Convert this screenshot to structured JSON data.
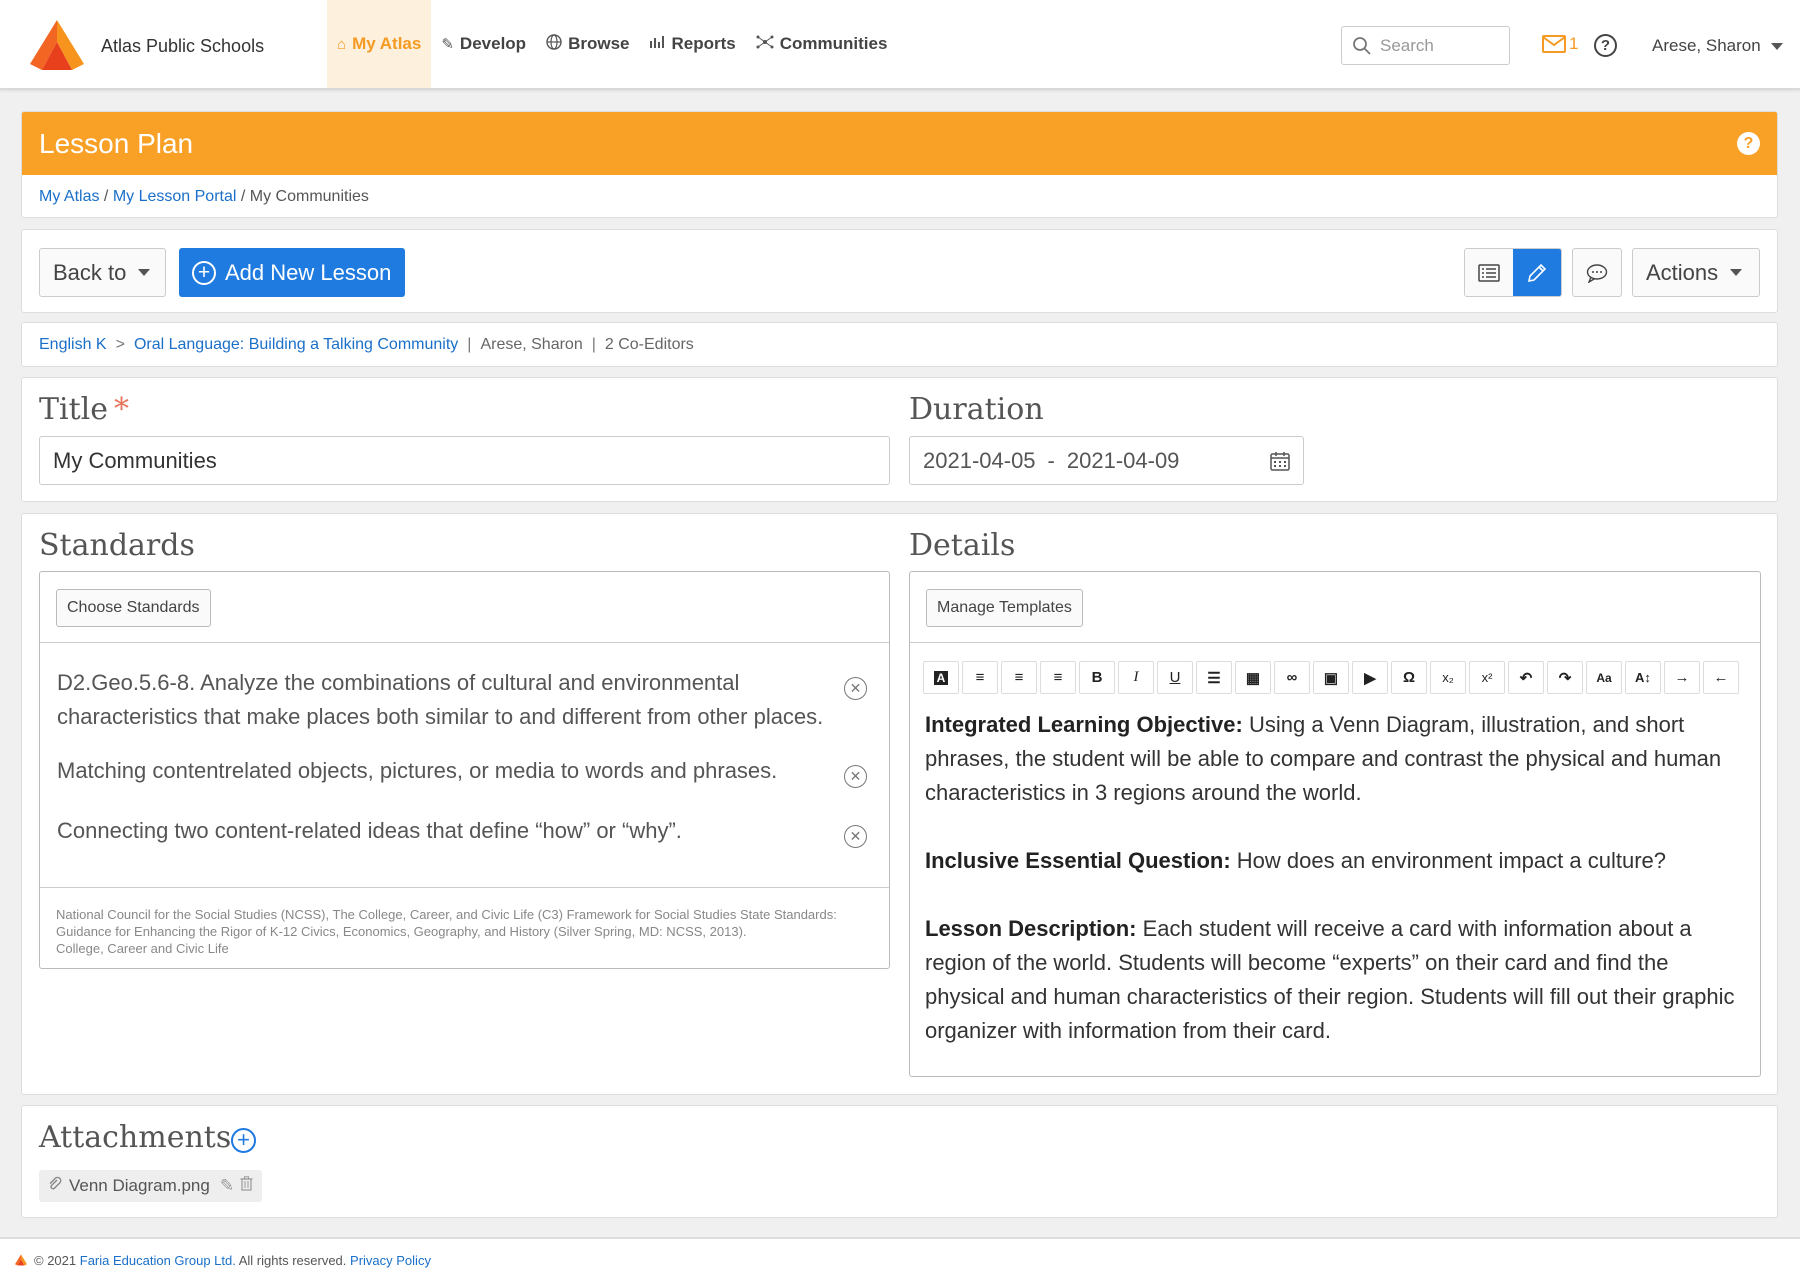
{
  "brand": {
    "name": "Atlas Public Schools",
    "accent": "#f59a23"
  },
  "nav": {
    "items": [
      {
        "label": "My Atlas",
        "icon": "home-icon",
        "active": true
      },
      {
        "label": "Develop",
        "icon": "edit-icon"
      },
      {
        "label": "Browse",
        "icon": "globe-icon"
      },
      {
        "label": "Reports",
        "icon": "bar-chart-icon"
      },
      {
        "label": "Communities",
        "icon": "network-icon"
      }
    ],
    "search_placeholder": "Search",
    "mail_count": "1",
    "help": "?",
    "user": "Arese, Sharon"
  },
  "page": {
    "title": "Lesson Plan",
    "help": "?",
    "breadcrumb": {
      "link1": "My Atlas",
      "link2": "My Lesson Portal",
      "current": "My Communities",
      "sep": " / "
    }
  },
  "toolbar": {
    "back_label": "Back to",
    "add_label": "Add New Lesson",
    "actions_label": "Actions"
  },
  "course": {
    "course": "English K",
    "arrow": ">",
    "unit": "Oral Language: Building a Talking Community",
    "author": "Arese, Sharon",
    "coeditors": "2 Co-Editors",
    "sep": "|"
  },
  "form": {
    "title_label": "Title",
    "required": "*",
    "title_value": "My Communities",
    "duration_label": "Duration",
    "start_date": "2021-04-05",
    "date_sep": "-",
    "end_date": "2021-04-09"
  },
  "standards": {
    "heading": "Standards",
    "choose_label": "Choose Standards",
    "items": [
      "D2.Geo.5.6-8. Analyze the combinations of cultural and environmental characteristics that make places both similar to and different from other places.",
      "Matching contentrelated objects, pictures, or media to words and phrases.",
      "Connecting two content-related ideas that define “how” or “why”."
    ],
    "remove_symbol": "✕",
    "source_line1": "National Council for the Social Studies (NCSS), The College, Career, and Civic Life (C3) Framework for Social Studies State Standards: Guidance for Enhancing the Rigor of K-12 Civics, Economics, Geography, and History (Silver Spring, MD: NCSS, 2013).",
    "source_line2": "College, Career and Civic Life"
  },
  "details": {
    "heading": "Details",
    "templates_label": "Manage Templates",
    "format_buttons": [
      "font-color-icon",
      "align-left-icon",
      "align-center-icon",
      "align-right-icon",
      "bold-icon",
      "italic-icon",
      "underline-icon",
      "bullet-list-icon",
      "table-icon",
      "link-icon",
      "image-icon",
      "video-icon",
      "omega-icon",
      "subscript-icon",
      "superscript-icon",
      "undo-icon",
      "redo-icon",
      "font-size-icon",
      "line-height-icon",
      "indent-icon",
      "outdent-icon"
    ],
    "p1_label": "Integrated Learning Objective:",
    "p1_text": " Using a Venn Diagram, illustration, and short phrases, the student will be able to compare and contrast the physical and human characteristics in 3 regions around the world.",
    "p2_label": "Inclusive Essential Question:",
    "p2_text": " How does an environment impact a culture?",
    "p3_label": "Lesson Description:",
    "p3_text": " Each student will receive a card with information about a region of the world. Students will become “experts” on their card and find the physical and human characteristics of their region. Students will fill out their graphic organizer with information from their card."
  },
  "attachments": {
    "heading": "Attachments",
    "add": "+",
    "file": "Venn Diagram.png"
  },
  "footer": {
    "copyright": "© 2021",
    "company": "Faria Education Group Ltd.",
    "rights": "All rights reserved.",
    "privacy": "Privacy Policy"
  }
}
